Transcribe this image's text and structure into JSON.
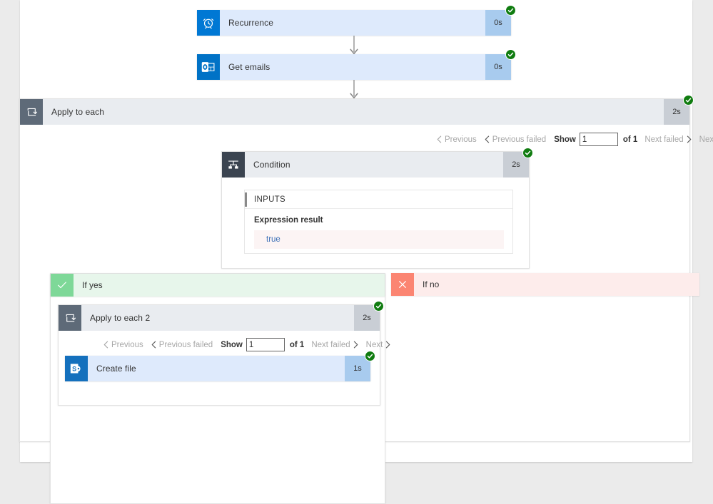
{
  "theme": {
    "page_background": "#ebebeb",
    "canvas_background": "#ffffff",
    "connector_card_background": "#deeafc",
    "connector_duration_background": "#a8cbee",
    "control_card_background": "#e9ecf0",
    "control_duration_background": "#c9ced5",
    "control_icon_background": "#5e6a78",
    "brand_blue": "#0078d4",
    "outlook_blue": "#0072c6",
    "sharepoint_teal": "#036c70",
    "success_green": "#107c10",
    "if_yes_header": "#e7f6eb",
    "if_yes_icon": "#7ed898",
    "if_no_header": "#fdeceb",
    "if_no_icon": "#fb8572",
    "expression_value_text": "#3b6fb6",
    "expression_value_background": "#fcf4f4"
  },
  "flow": {
    "trigger": {
      "name": "Recurrence",
      "duration": "0s",
      "status": "succeeded",
      "icon": "alarm-clock-icon"
    },
    "get_emails": {
      "name": "Get emails",
      "duration": "0s",
      "status": "succeeded",
      "icon": "outlook-icon"
    },
    "apply_to_each": {
      "name": "Apply to each",
      "duration": "2s",
      "status": "succeeded",
      "icon": "loop-icon",
      "pager": {
        "previous_label": "Previous",
        "previous_failed_label": "Previous failed",
        "show_label": "Show",
        "page_value": "1",
        "of_label": "of 1",
        "next_failed_label": "Next failed",
        "next_label": "Next"
      }
    },
    "condition": {
      "name": "Condition",
      "duration": "2s",
      "status": "succeeded",
      "icon": "condition-icon",
      "inputs": {
        "section_title": "INPUTS",
        "field_label": "Expression result",
        "field_value": "true"
      }
    },
    "if_yes": {
      "label": "If yes",
      "icon": "checkmark-icon"
    },
    "if_no": {
      "label": "If no",
      "icon": "close-icon"
    },
    "apply_to_each_2": {
      "name": "Apply to each 2",
      "duration": "2s",
      "status": "succeeded",
      "icon": "loop-icon",
      "pager": {
        "previous_label": "Previous",
        "previous_failed_label": "Previous failed",
        "show_label": "Show",
        "page_value": "1",
        "of_label": "of 1",
        "next_failed_label": "Next failed",
        "next_label": "Next"
      }
    },
    "create_file": {
      "name": "Create file",
      "duration": "1s",
      "status": "succeeded",
      "icon": "sharepoint-icon"
    }
  }
}
